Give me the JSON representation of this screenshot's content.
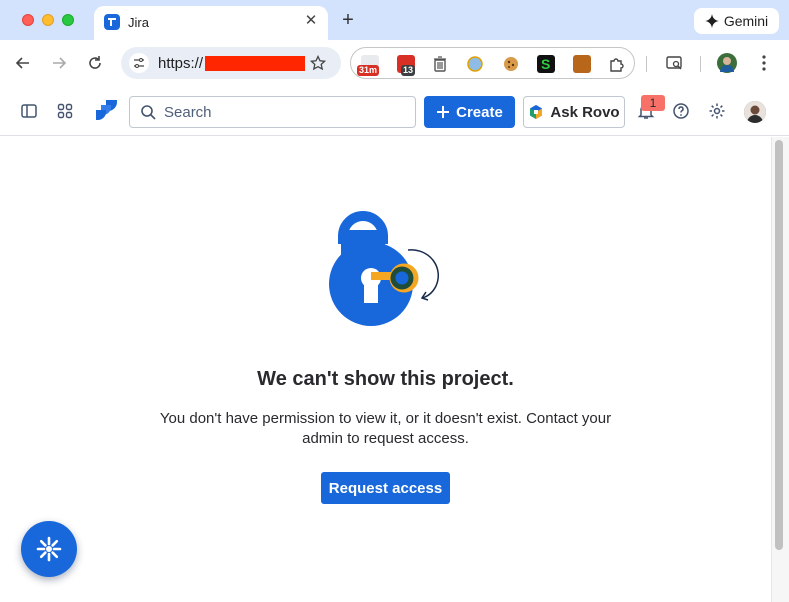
{
  "browser": {
    "tab_title": "Jira",
    "new_tab_glyph": "+",
    "close_glyph": "✕",
    "url_prefix": "https://",
    "gemini_label": "Gemini",
    "extensions": [
      {
        "name": "calendar-extension-icon",
        "badge": "31m",
        "badge_color": "#d93025"
      },
      {
        "name": "mail-extension-icon",
        "badge": "13",
        "badge_color": "#3c4043"
      },
      {
        "name": "trash-extension-icon"
      },
      {
        "name": "globe-extension-icon"
      },
      {
        "name": "cookie-extension-icon"
      },
      {
        "name": "s-extension-icon"
      },
      {
        "name": "notebook-extension-icon"
      },
      {
        "name": "puzzle-extensions-icon"
      }
    ]
  },
  "jira_nav": {
    "search_placeholder": "Search",
    "create_label": "Create",
    "ask_rovo_label": "Ask Rovo",
    "notification_count": "1"
  },
  "error_page": {
    "heading": "We can't show this project.",
    "description": "You don't have permission to view it, or it doesn't exist. Contact your admin to request access.",
    "request_button": "Request access"
  },
  "colors": {
    "brand_blue": "#1868db",
    "titlebar": "#d3e3fd",
    "badge_red": "#f87168",
    "lock_key_yellow": "#f5a623",
    "lock_key_green": "#1f4d3a"
  }
}
